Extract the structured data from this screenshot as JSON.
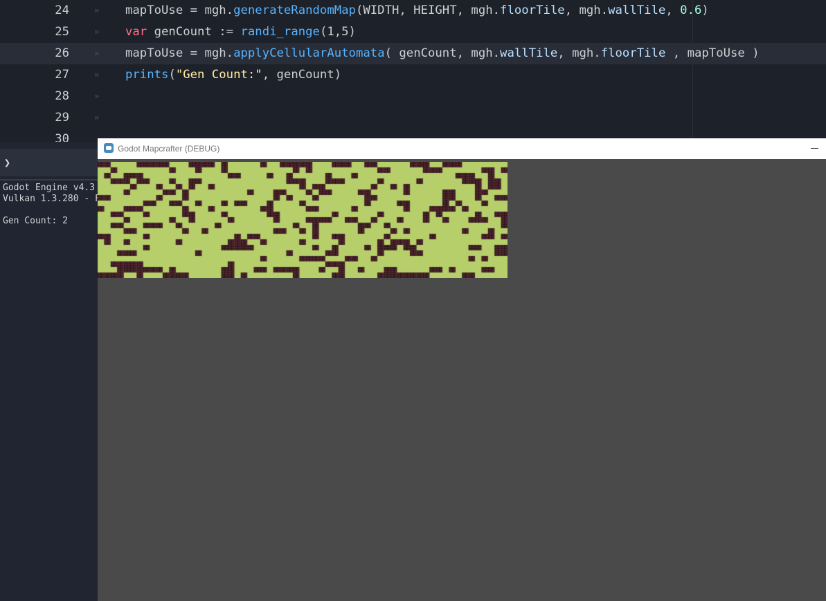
{
  "editor": {
    "lines": [
      {
        "number": "24",
        "tokens": [
          {
            "t": "mapToUse = mgh.",
            "c": ""
          },
          {
            "t": "generateRandomMap",
            "c": "t-fn"
          },
          {
            "t": "(WIDTH, HEIGHT, mgh.",
            "c": ""
          },
          {
            "t": "floorTile",
            "c": "t-mem"
          },
          {
            "t": ", mgh.",
            "c": ""
          },
          {
            "t": "wallTile",
            "c": "t-mem"
          },
          {
            "t": ", ",
            "c": ""
          },
          {
            "t": "0.6",
            "c": "t-num"
          },
          {
            "t": ")",
            "c": ""
          }
        ]
      },
      {
        "number": "25",
        "tokens": [
          {
            "t": "var",
            "c": "t-kw"
          },
          {
            "t": " genCount := ",
            "c": ""
          },
          {
            "t": "randi_range",
            "c": "t-fn"
          },
          {
            "t": "(1,5)",
            "c": ""
          }
        ]
      },
      {
        "number": "26",
        "current": true,
        "tokens": [
          {
            "t": "mapToUse = mgh.",
            "c": ""
          },
          {
            "t": "applyCellularAutomata",
            "c": "t-fn"
          },
          {
            "t": "( genCount, mgh.",
            "c": ""
          },
          {
            "t": "wallTile",
            "c": "t-mem"
          },
          {
            "t": ", mgh.",
            "c": ""
          },
          {
            "t": "floorTile",
            "c": "t-mem"
          },
          {
            "t": " , mapToUse )",
            "c": ""
          }
        ]
      },
      {
        "number": "27",
        "tokens": [
          {
            "t": "prints",
            "c": "t-fn"
          },
          {
            "t": "(",
            "c": ""
          },
          {
            "t": "\"Gen Count:\"",
            "c": "t-str"
          },
          {
            "t": ", genCount)",
            "c": ""
          }
        ]
      },
      {
        "number": "28",
        "tokens": []
      },
      {
        "number": "29",
        "tokens": []
      },
      {
        "number": "30",
        "tokens": []
      }
    ]
  },
  "output": {
    "toggle_glyph": "❯",
    "engine_line": "Godot Engine v4.3",
    "vulkan_line": "Vulkan 1.3.280 - F",
    "gen_count_line": "Gen Count: 2"
  },
  "game_window": {
    "title": "Godot Mapcrafter (DEBUG)"
  },
  "tilemap": {
    "floor_color": "#b6cf6a",
    "wall_color": "#5a2a35",
    "mortar_color": "#2a1418",
    "rows": [
      "##....#####...####.#.....#..#####...###..##.....###..###.......",
      "..#........#...#...#..........#.#..........##.....###......##.#",
      ".#..###.............##....#..#.....#...#...............###..#..",
      "..###.##...#..##.............###...###.....#.....#......###.##.",
      ".....#...#..#.#..#.............#.##.......#..#.#..........#.##.",
      "....#.....##.#.........#...##...#.##....##.....#.....##...##...",
      "##.......#...#.............#.#...#.......##..........##...#..##",
      ".......##..##..#...#.##...#....#.........#....##.....#.#...#...",
      "#...###......#...#.......##.....##.....#.......#...####.#......",
      "..##...#.....##....#......##........#......#......#.#.....#..##",
      "....#......#..#.....#......#....####..##..#...#...#..#...###..#",
      "..##...###..#.....#...........#..#......##..#.................#",
      "....##.......#..#..........##..#.#......#....#.#........#...#..",
      "##.....#.............#.##........#..##......#......#.......##.#",
      ".#..#.......#.......###..#.....#.....#.....#.###.#.............",
      ".......#...........#####.........#..#....#.###.##........##..##",
      "...###.........#.............#.....##......#....##...........##",
      ".........................#.....####...##..#..............#.#...",
      "..#####.............#..............###.........................",
      "...#######.#.......##...##.####...#..#..#...##.....##.#....##..",
      "####..#...####.....##.#.......#.....##.....########.....##....."
    ]
  }
}
